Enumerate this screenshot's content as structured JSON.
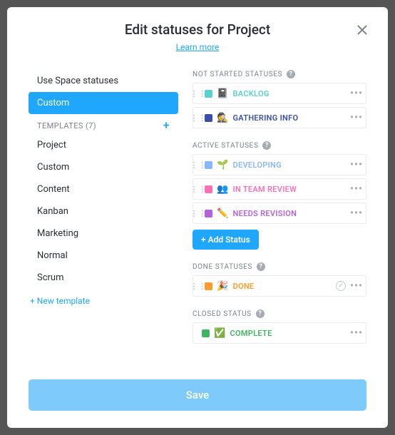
{
  "header": {
    "title": "Edit statuses for Project",
    "learn_more": "Learn more"
  },
  "close_label": "×",
  "left": {
    "use_space": "Use Space statuses",
    "custom": "Custom",
    "templates_header": "TEMPLATES (7)",
    "templates": [
      {
        "label": "Project"
      },
      {
        "label": "Custom"
      },
      {
        "label": "Content"
      },
      {
        "label": "Kanban"
      },
      {
        "label": "Marketing"
      },
      {
        "label": "Normal"
      },
      {
        "label": "Scrum"
      }
    ],
    "new_template": "+ New template"
  },
  "groups": {
    "not_started": {
      "label": "NOT STARTED STATUSES",
      "statuses": [
        {
          "color": "#59d1d1",
          "emoji": "📓",
          "label": "BACKLOG",
          "label_color": "#59d1d1"
        },
        {
          "color": "#3a4eab",
          "emoji": "🕵️",
          "label": "GATHERING INFO",
          "label_color": "#3a4eab"
        }
      ]
    },
    "active": {
      "label": "ACTIVE STATUSES",
      "statuses": [
        {
          "color": "#8ab6ff",
          "emoji": "🌱",
          "label": "DEVELOPING",
          "label_color": "#8ab6ff"
        },
        {
          "color": "#ff6fb4",
          "emoji": "👥",
          "label": "IN TEAM REVIEW",
          "label_color": "#ff6fb4"
        },
        {
          "color": "#b660e0",
          "emoji": "✏️",
          "label": "NEEDS REVISION",
          "label_color": "#b660e0"
        }
      ],
      "add_label": "+ Add Status"
    },
    "done": {
      "label": "DONE STATUSES",
      "statuses": [
        {
          "color": "#ff9b2a",
          "emoji": "🎉",
          "label": "DONE",
          "label_color": "#ff9b2a"
        }
      ]
    },
    "closed": {
      "label": "CLOSED STATUS",
      "status": {
        "color": "#3db65f",
        "emoji": "✅",
        "label": "COMPLETE",
        "label_color": "#3db65f"
      }
    }
  },
  "save_label": "Save"
}
